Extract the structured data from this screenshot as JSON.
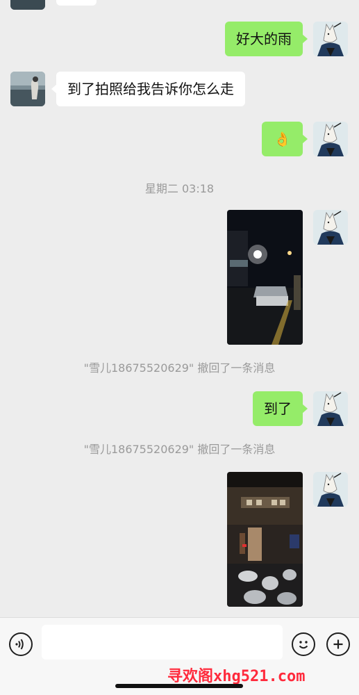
{
  "messages": {
    "m1": "好大的雨",
    "m2": "到了拍照给我告诉你怎么走",
    "m3_emoji": "👌",
    "time_divider": "星期二 03:18",
    "recall_1": "\"雪儿18675520629\" 撤回了一条消息",
    "m4": "到了",
    "recall_2": "\"雪儿18675520629\" 撤回了一条消息"
  },
  "input_bar": {
    "voice_icon": "voice-icon",
    "emoji_icon": "emoji-icon",
    "plus_icon": "plus-icon"
  },
  "watermark": "寻欢阁xhg521.com",
  "colors": {
    "chat_background": "#ededed",
    "outgoing_bubble": "#95ec69",
    "incoming_bubble": "#ffffff",
    "system_text": "#9a9a9a",
    "watermark": "#ff2a3c"
  }
}
